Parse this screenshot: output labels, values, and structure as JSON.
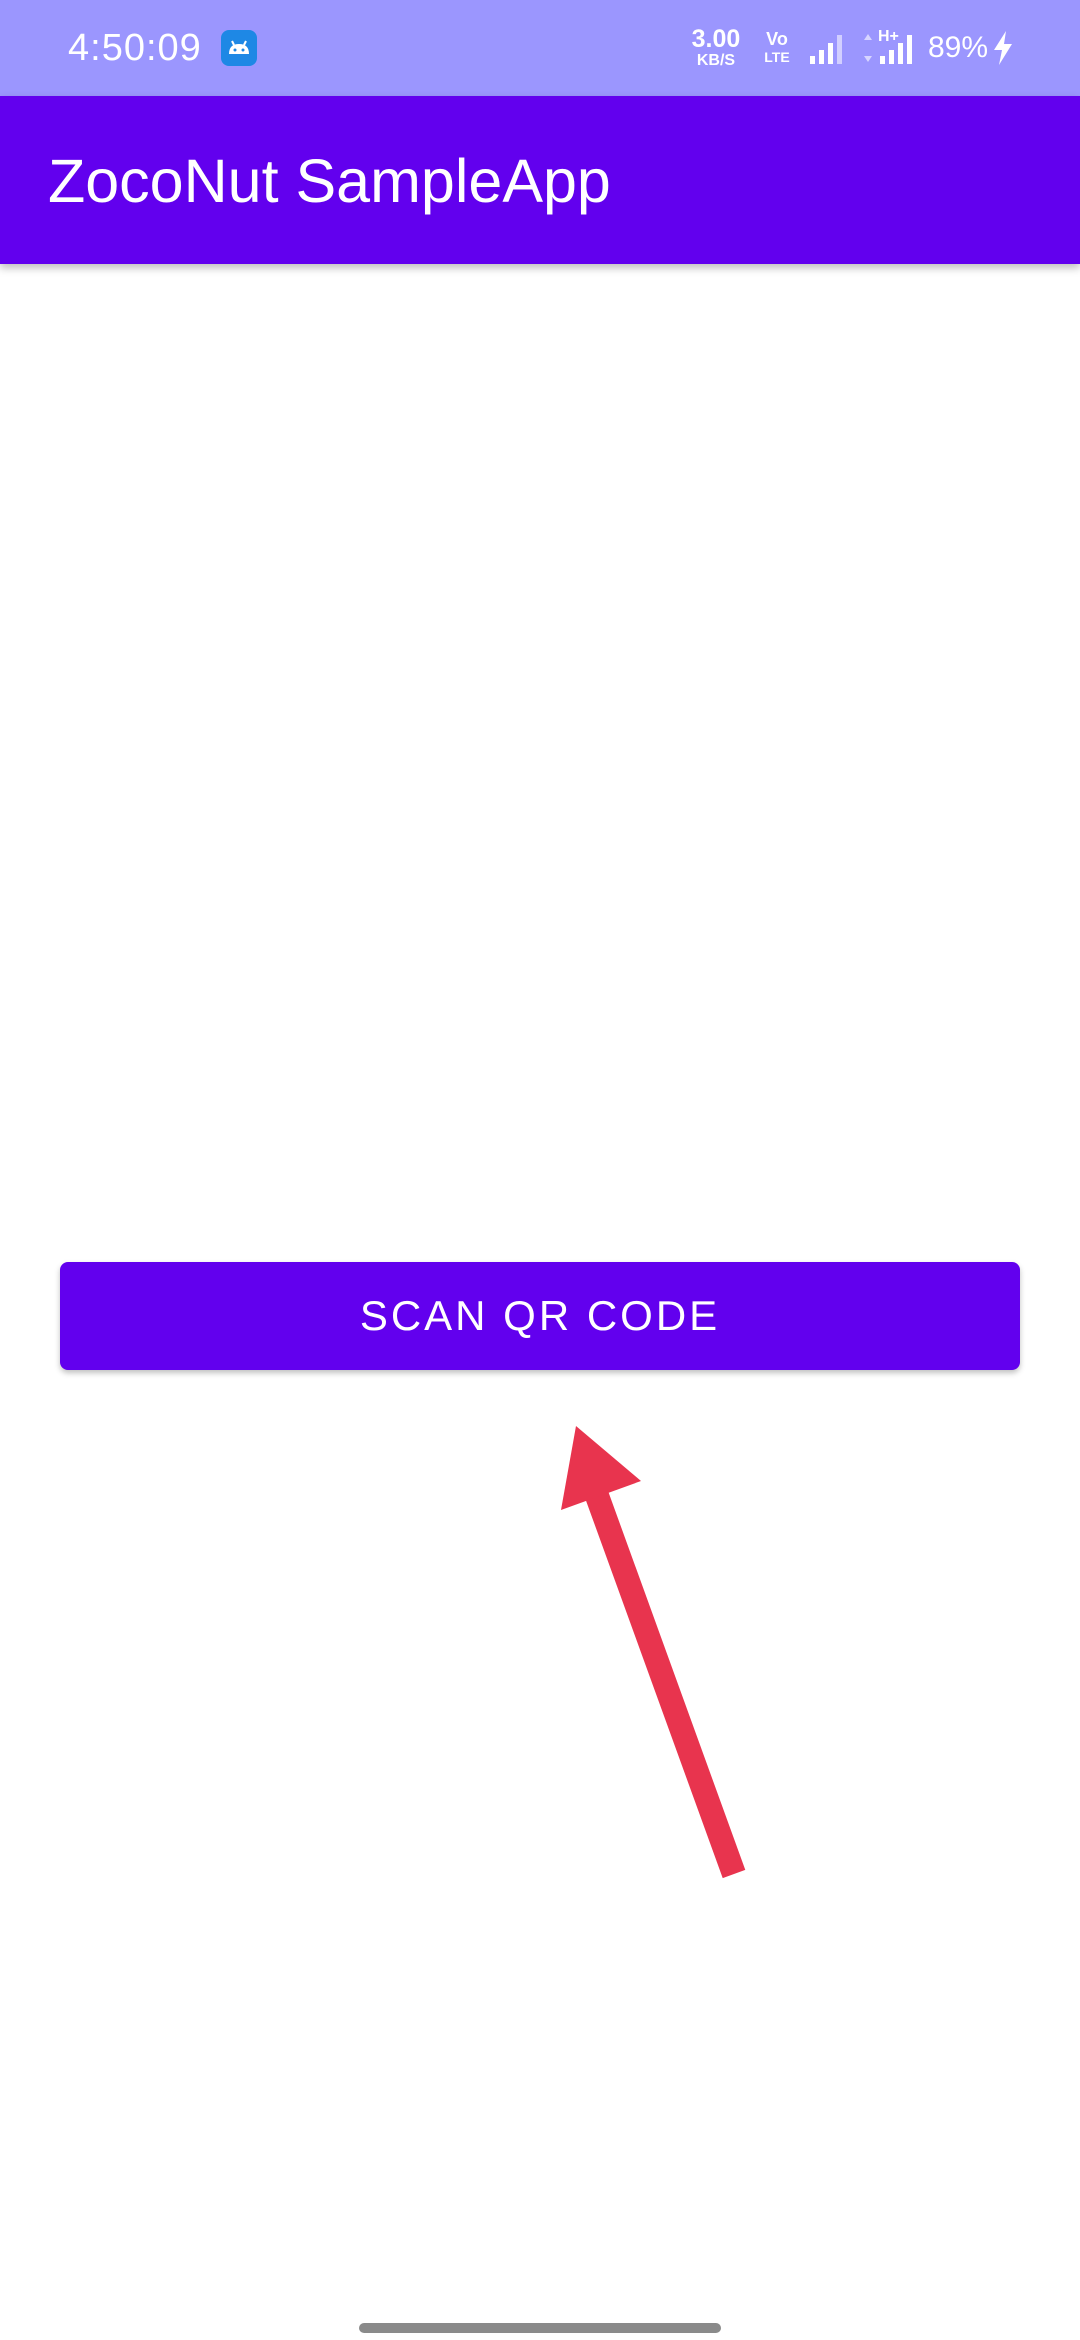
{
  "status_bar": {
    "time": "4:50:09",
    "net_speed_value": "3.00",
    "net_speed_unit": "KB/S",
    "volte_top": "Vo",
    "volte_bottom": "LTE",
    "network_type": "H+",
    "battery": "89%",
    "icons": [
      "android-notification-icon",
      "signal-icon",
      "data-arrows-icon",
      "signal-icon",
      "charging-icon"
    ],
    "background_color": "#9b96fe"
  },
  "app_bar": {
    "title": "ZocoNut SampleApp",
    "background_color": "#6200ee"
  },
  "main": {
    "scan_button_label": "SCAN QR CODE",
    "button_color": "#6200ee"
  },
  "annotation": {
    "arrow_color": "#e8344e",
    "icon": "arrow-pointer-annotation"
  }
}
